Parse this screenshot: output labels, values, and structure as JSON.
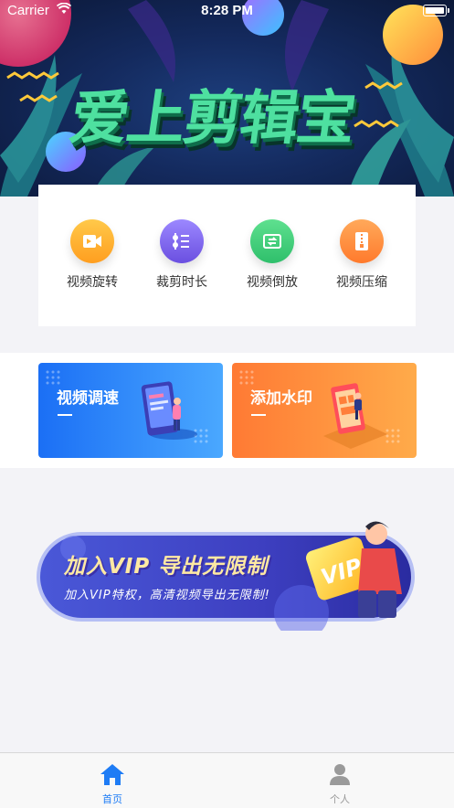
{
  "status_bar": {
    "carrier": "Carrier",
    "time": "8:28 PM"
  },
  "banner": {
    "title": "爱上剪辑宝"
  },
  "tools": [
    {
      "label": "视频旋转",
      "icon": "video-rotate-icon",
      "color": "#ffb02e"
    },
    {
      "label": "裁剪时长",
      "icon": "trim-duration-icon",
      "color": "#7d64ea"
    },
    {
      "label": "视频倒放",
      "icon": "reverse-icon",
      "color": "#3fcf7c"
    },
    {
      "label": "视频压缩",
      "icon": "compress-icon",
      "color": "#ff8a3d"
    }
  ],
  "features": [
    {
      "label": "视频调速",
      "colors": [
        "#1b6ff5",
        "#4aa8ff"
      ]
    },
    {
      "label": "添加水印",
      "colors": [
        "#ff7a34",
        "#ffab4a"
      ]
    }
  ],
  "vip": {
    "title": "加入VIP 导出无限制",
    "subtitle": "加入VIP特权，高清视频导出无限制!"
  },
  "tab_bar": {
    "tabs": [
      {
        "label": "首页",
        "icon": "home-icon",
        "active": true,
        "color": "#1e7cf5"
      },
      {
        "label": "个人",
        "icon": "person-icon",
        "active": false,
        "color": "#999999"
      }
    ]
  }
}
